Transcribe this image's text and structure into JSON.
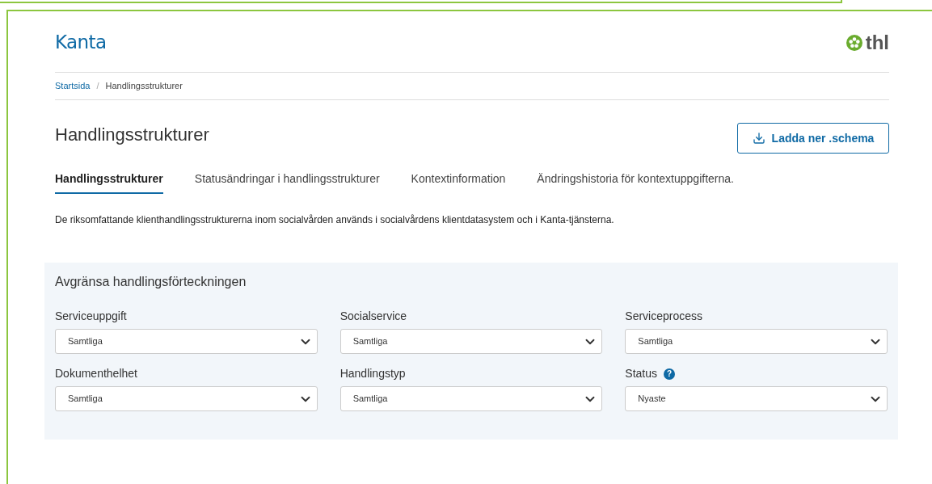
{
  "header": {
    "logo": "Kanta",
    "partner_logo": "thl"
  },
  "breadcrumb": [
    {
      "label": "Startsida",
      "link": true
    },
    {
      "label": "/",
      "kind": "separator"
    },
    {
      "label": "Handlingsstrukturer",
      "link": false
    }
  ],
  "page_title": "Handlingsstrukturer",
  "download_button": "Ladda ner .schema",
  "tabs": [
    {
      "label": "Handlingsstrukturer",
      "selected": true
    },
    {
      "label": "Statusändringar i handlingsstrukturer",
      "selected": false
    },
    {
      "label": "Kontextinformation",
      "selected": false
    },
    {
      "label": "Ändringshistoria för kontextuppgifterna.",
      "selected": false
    }
  ],
  "description": "De riksomfattande klienthandlingsstrukturerna inom socialvården används i socialvårdens klientdatasystem och i Kanta-tjänsterna.",
  "filter_panel": {
    "title": "Avgränsa handlingsförteckningen",
    "filters": [
      {
        "label": "Serviceuppgift",
        "value": "Samtliga"
      },
      {
        "label": "Socialservice",
        "value": "Samtliga"
      },
      {
        "label": "Serviceprocess",
        "value": "Samtliga"
      },
      {
        "label": "Dokumenthelhet",
        "value": "Samtliga"
      },
      {
        "label": "Handlingstyp",
        "value": "Samtliga"
      },
      {
        "label": "Status",
        "value": "Nyaste",
        "help_icon": "?"
      }
    ]
  }
}
